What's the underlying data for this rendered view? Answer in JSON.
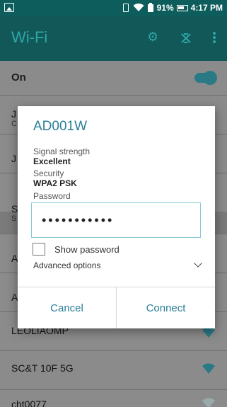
{
  "status_bar": {
    "battery": "91%",
    "time": "4:17 PM"
  },
  "header": {
    "title": "Wi-Fi"
  },
  "wifi_toggle": {
    "label": "On"
  },
  "networks": [
    {
      "name": "J",
      "sub": "C"
    },
    {
      "name": "J",
      "sub": ""
    },
    {
      "name": "S",
      "sub": "S"
    },
    {
      "name": "A",
      "sub": ""
    },
    {
      "name": "A",
      "sub": ""
    },
    {
      "name": "LEOLIAOMP",
      "sub": ""
    },
    {
      "name": "SC&T 10F 5G",
      "sub": ""
    },
    {
      "name": "cht0077",
      "sub": ""
    }
  ],
  "dialog": {
    "title": "AD001W",
    "signal_label": "Signal strength",
    "signal_value": "Excellent",
    "security_label": "Security",
    "security_value": "WPA2 PSK",
    "password_label": "Password",
    "password_value": "•••••••••••",
    "show_password_label": "Show password",
    "advanced_label": "Advanced options",
    "cancel_label": "Cancel",
    "connect_label": "Connect"
  },
  "colors": {
    "accent": "#2a7f96",
    "header_bg": "#0d5757"
  }
}
